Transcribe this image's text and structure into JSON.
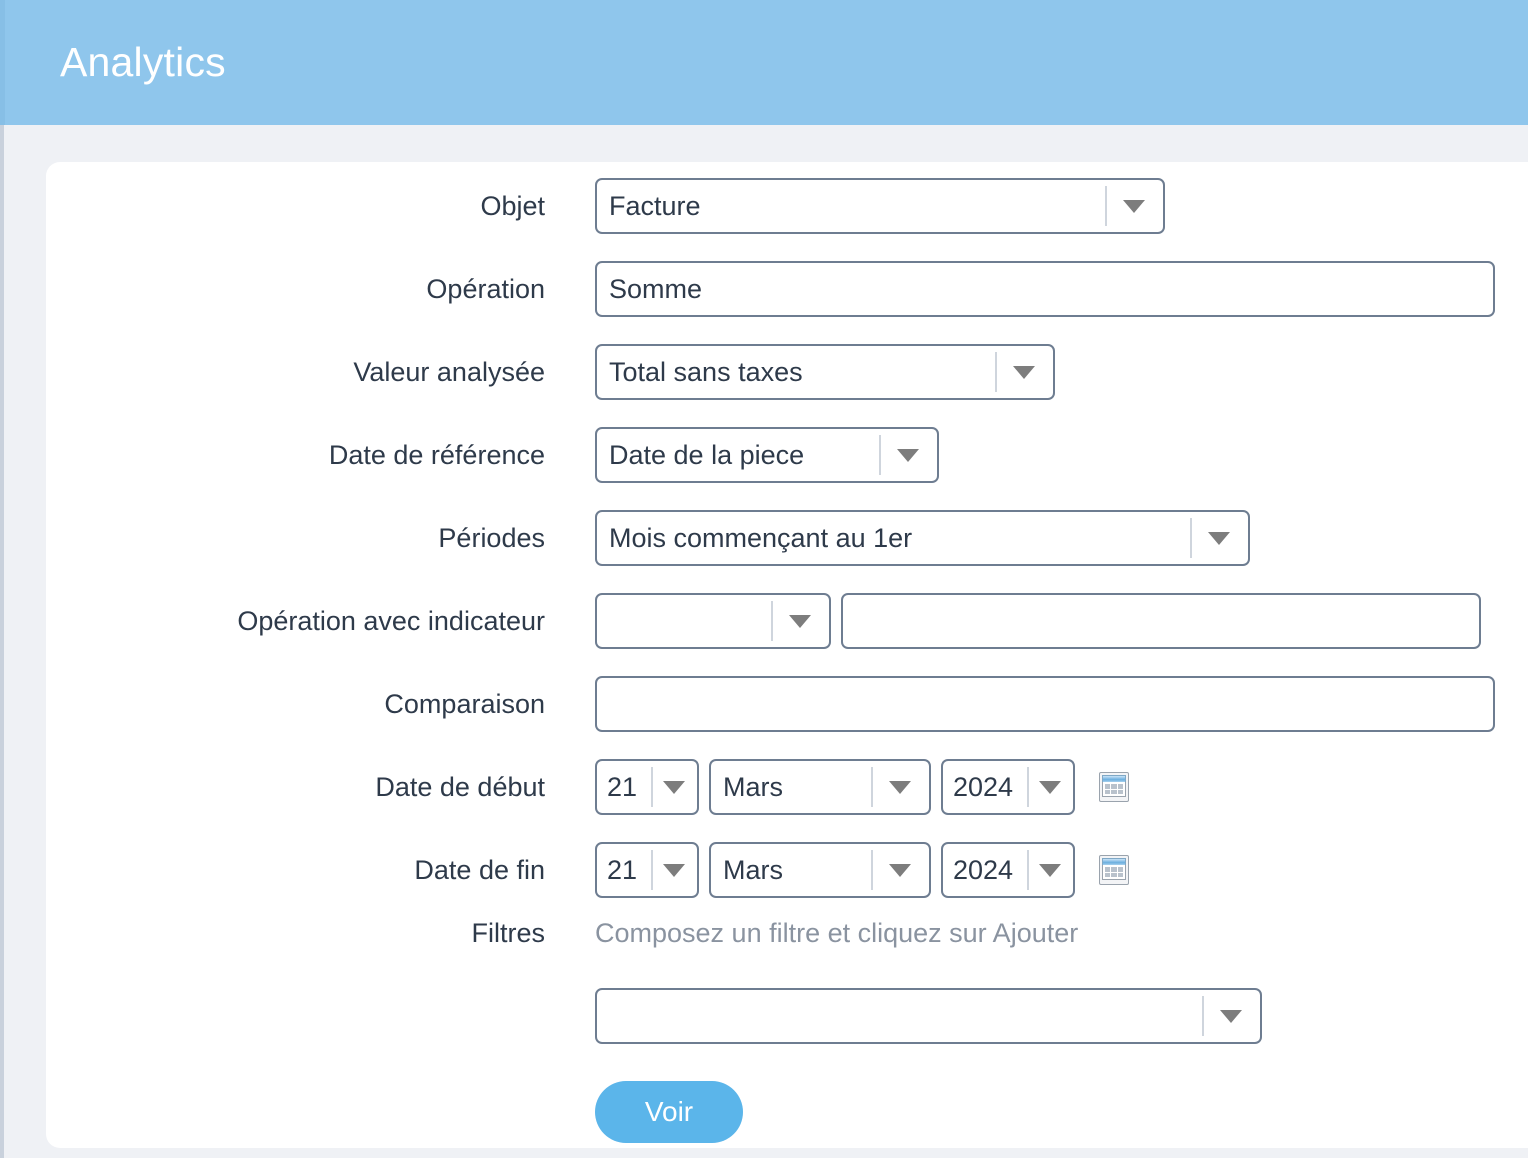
{
  "header": {
    "title": "Analytics",
    "bg_color": "#8fc6ec",
    "text_color": "#ffffff"
  },
  "theme": {
    "page_bg": "#eff1f5",
    "card_bg": "#ffffff",
    "label_color": "#2e3a4a",
    "field_border": "#6e7d91",
    "accent": "#5bb5ea",
    "muted_text": "#8a93a0"
  },
  "form": {
    "objet": {
      "label": "Objet",
      "value": "Facture",
      "icon": "chevron-down-icon"
    },
    "operation": {
      "label": "Opération",
      "value": "Somme"
    },
    "valeur_analysee": {
      "label": "Valeur analysée",
      "value": "Total sans taxes",
      "icon": "chevron-down-icon"
    },
    "date_reference": {
      "label": "Date de référence",
      "value": "Date de la piece",
      "icon": "chevron-down-icon"
    },
    "periodes": {
      "label": "Périodes",
      "value": "Mois commençant au 1er",
      "icon": "chevron-down-icon"
    },
    "operation_indicateur": {
      "label": "Opération avec indicateur",
      "select_value": "",
      "text_value": "",
      "icon": "chevron-down-icon"
    },
    "comparaison": {
      "label": "Comparaison",
      "value": ""
    },
    "date_debut": {
      "label": "Date de début",
      "day": "21",
      "month": "Mars",
      "year": "2024",
      "icon": "calendar-icon"
    },
    "date_fin": {
      "label": "Date de fin",
      "day": "21",
      "month": "Mars",
      "year": "2024",
      "icon": "calendar-icon"
    },
    "filtres": {
      "label": "Filtres",
      "hint": "Composez un filtre et cliquez sur Ajouter",
      "select_value": "",
      "icon": "chevron-down-icon"
    },
    "submit": {
      "label": "Voir"
    }
  }
}
